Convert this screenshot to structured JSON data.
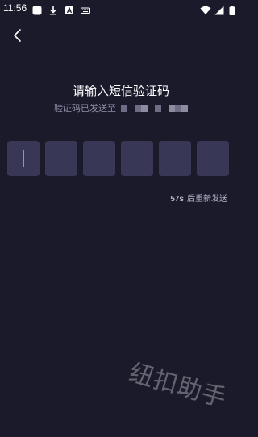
{
  "status_bar": {
    "time": "11:56",
    "left_icons": [
      "app-icon",
      "download-icon",
      "a-badge-icon",
      "keyboard-icon"
    ],
    "right_icons": [
      "wifi-icon",
      "signal-icon",
      "battery-icon"
    ]
  },
  "header": {
    "back_icon": "chevron-left-icon"
  },
  "main": {
    "title": "请输入短信验证码",
    "sent_to_label": "验证码已发送至",
    "code_box_count": 6,
    "resend_seconds": "57s",
    "resend_text": "后重新发送"
  },
  "watermark": "纽扣助手",
  "colors": {
    "background": "#1b1a2b",
    "code_box": "#383856",
    "cursor": "#3fb7d9",
    "subtext": "#8f8ea6"
  }
}
